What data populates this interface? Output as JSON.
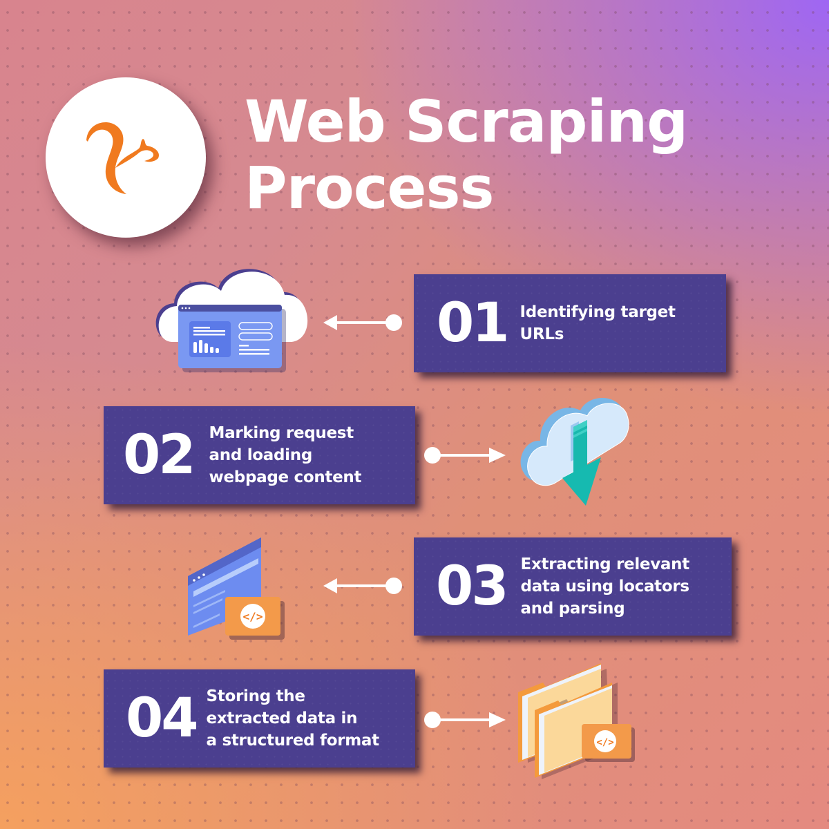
{
  "title": {
    "line1": "Web Scraping",
    "line2": "Process"
  },
  "logo": {
    "icon": "squirrel-logo-icon",
    "color": "#f07a1f"
  },
  "colors": {
    "panel_bg": "#4b3f8f",
    "text": "#ffffff",
    "accent_orange": "#f39a4a",
    "accent_purple": "#9b64fa",
    "teal_arrow": "#15bcb2",
    "cloud_light": "#d6e9fb",
    "cloud_side": "#7ab8e8",
    "browser_blue": "#6d8cf0"
  },
  "steps": [
    {
      "number": "01",
      "lines": [
        "Identifying target",
        "URLs"
      ],
      "connector": "arrow-left",
      "illustration": "cloud-dashboard-icon"
    },
    {
      "number": "02",
      "lines": [
        "Marking request",
        "and loading",
        "webpage content"
      ],
      "connector": "arrow-right",
      "illustration": "cloud-download-icon"
    },
    {
      "number": "03",
      "lines": [
        "Extracting relevant",
        "data using locators",
        "and parsing"
      ],
      "connector": "arrow-left",
      "illustration": "browser-code-icon"
    },
    {
      "number": "04",
      "lines": [
        "Storing the",
        "extracted data in",
        "a structured format"
      ],
      "connector": "arrow-right",
      "illustration": "folders-code-icon"
    }
  ]
}
